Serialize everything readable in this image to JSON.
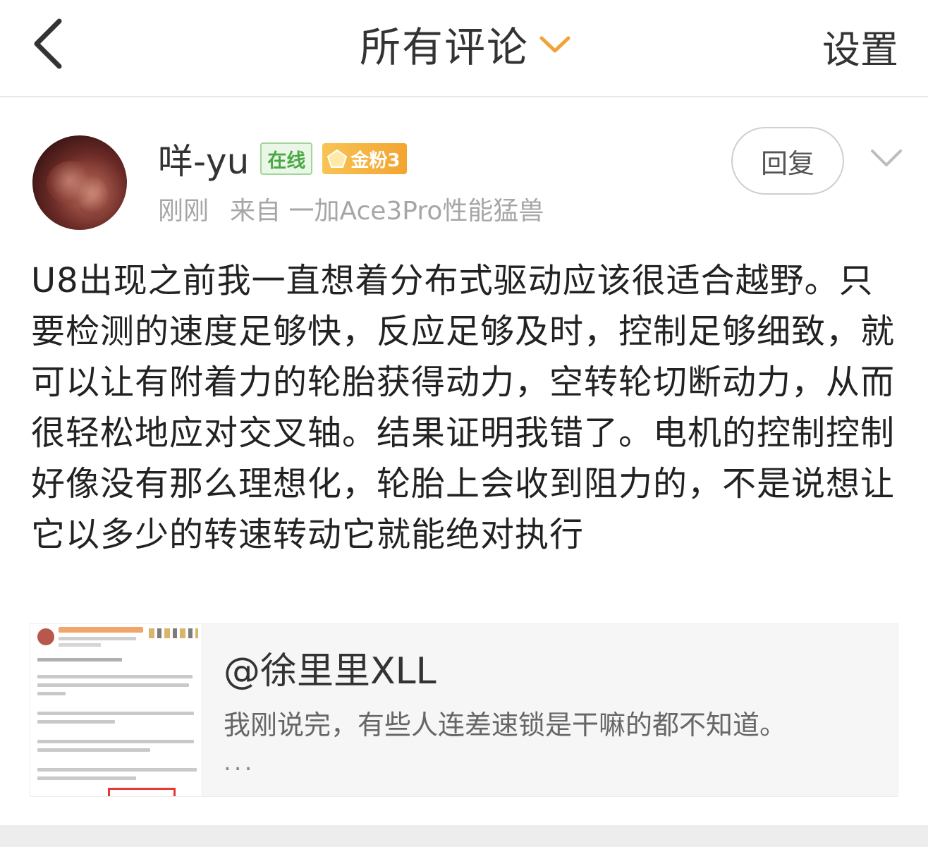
{
  "header": {
    "title": "所有评论",
    "settings_label": "设置",
    "accent_color": "#f2a23a"
  },
  "comment": {
    "username": "咩-yu",
    "online_badge": "在线",
    "fan_badge": "金粉3",
    "time": "刚刚",
    "source": "来自 一加Ace3Pro性能猛兽",
    "reply_label": "回复",
    "text": "U8出现之前我一直想着分布式驱动应该很适合越野。只要检测的速度足够快，反应足够及时，控制足够细致，就可以让有附着力的轮胎获得动力，空转轮切断动力，从而很轻松地应对交叉轴。结果证明我错了。电机的控制控制好像没有那么理想化，轮胎上会收到阻力的，不是说想让它以多少的转速转动它就能绝对执行"
  },
  "quote": {
    "user": "@徐里里XLL",
    "text": "我刚说完，有些人连差速锁是干嘛的都不知道。",
    "more": "..."
  },
  "icons": {
    "back": "back-chevron-icon",
    "title_dropdown": "chevron-down-icon",
    "more": "chevron-down-icon",
    "fan_badge": "diamond-icon"
  }
}
